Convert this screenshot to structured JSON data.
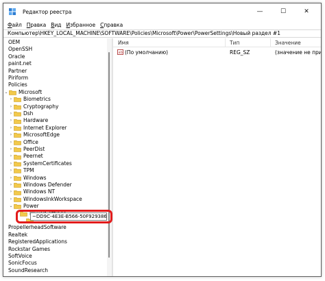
{
  "window": {
    "title": "Редактор реестра",
    "buttons": {
      "minimize": "—",
      "maximize": "☐",
      "close": "✕"
    }
  },
  "menu": [
    {
      "pre": "",
      "hot": "Ф",
      "post": "айл"
    },
    {
      "pre": "",
      "hot": "П",
      "post": "равка"
    },
    {
      "pre": "",
      "hot": "В",
      "post": "ид"
    },
    {
      "pre": "",
      "hot": "И",
      "post": "збранное"
    },
    {
      "pre": "",
      "hot": "С",
      "post": "правка"
    }
  ],
  "address": "Компьютер\\HKEY_LOCAL_MACHINE\\SOFTWARE\\Policies\\Microsoft\\Power\\PowerSettings\\Новый раздел #1",
  "tree": {
    "top_items": [
      "OEM",
      "OpenSSH",
      "Oracle",
      "paint.net",
      "Partner",
      "Piriform",
      "Policies"
    ],
    "microsoft": "Microsoft",
    "microsoft_children": [
      "Biometrics",
      "Cryptography",
      "Dsh",
      "Hardware",
      "Internet Explorer",
      "MicrosoftEdge",
      "Office",
      "PeerDist",
      "Peernet",
      "SystemCertificates",
      "TPM",
      "Windows",
      "Windows Defender",
      "Windows NT",
      "WindowsInkWorkspace"
    ],
    "power": "Power",
    "power_settings": "PowerSettings",
    "new_key_edit": "~DD9C-4E3E-B566-50F929386280",
    "bottom_items": [
      "PropellerheadSoftware",
      "Realtek",
      "RegisteredApplications",
      "Rockstar Games",
      "SoftVoice",
      "SonicFocus",
      "SoundResearch"
    ]
  },
  "list": {
    "headers": {
      "name": "Имя",
      "type": "Тип",
      "value": "Значение"
    },
    "rows": [
      {
        "name": "(По умолчанию)",
        "type": "REG_SZ",
        "value": "(значение не присвоено)"
      }
    ]
  },
  "colors": {
    "folder": "#f2c94c",
    "highlight": "#e21b1b",
    "accent": "#0078d7"
  },
  "icons": {
    "app": "registry-icon",
    "folder": "folder-icon",
    "value": "string-value-icon"
  }
}
